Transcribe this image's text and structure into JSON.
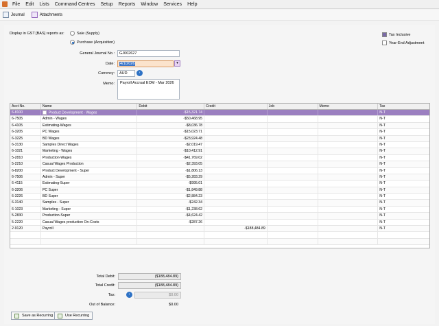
{
  "menu": [
    "File",
    "Edit",
    "Lists",
    "Command Centres",
    "Setup",
    "Reports",
    "Window",
    "Services",
    "Help"
  ],
  "toolbar": {
    "journal": "Journal",
    "attachments": "Attachments"
  },
  "gst": {
    "label": "Display in GST [BAS] reports as:",
    "sale": "Sale (Supply)",
    "purchase": "Purchase (Acquisition)",
    "selected": "purchase"
  },
  "options": {
    "tax_inclusive": "Tax Inclusive",
    "year_end": "Year-End Adjustment"
  },
  "form": {
    "journal_no_label": "General Journal No.:",
    "journal_no": "GJ002627",
    "date_label": "Date:",
    "date": "4/1/2026",
    "currency_label": "Currency:",
    "currency": "AUD",
    "memo_label": "Memo:",
    "memo": "Payroll Accrual EOM - Mar 2026"
  },
  "columns": [
    "Acct No.",
    "Name",
    "Debit",
    "Credit",
    "Job",
    "Memo",
    "Tax"
  ],
  "rows": [
    {
      "acct": "6-8100",
      "name": "Product Development - Wages",
      "debit": "-$15,321.74",
      "credit": "",
      "job": "",
      "memo": "",
      "tax": "N-T"
    },
    {
      "acct": "6-7505",
      "name": "Admin - Wages",
      "debit": "-$50,468.95",
      "credit": "",
      "job": "",
      "memo": "",
      "tax": "N-T"
    },
    {
      "acct": "6-4105",
      "name": "Estimating-Wages",
      "debit": "-$8,036.78",
      "credit": "",
      "job": "",
      "memo": "",
      "tax": "N-T"
    },
    {
      "acct": "6-3205",
      "name": "PC Wages",
      "debit": "-$15,023.71",
      "credit": "",
      "job": "",
      "memo": "",
      "tax": "N-T"
    },
    {
      "acct": "6-3225",
      "name": "BD Wages",
      "debit": "-$23,924.48",
      "credit": "",
      "job": "",
      "memo": "",
      "tax": "N-T"
    },
    {
      "acct": "6-3130",
      "name": "Samples Direct Wages",
      "debit": "-$2,019.47",
      "credit": "",
      "job": "",
      "memo": "",
      "tax": "N-T"
    },
    {
      "acct": "6-1021",
      "name": "Marketing - Wages",
      "debit": "-$10,412.91",
      "credit": "",
      "job": "",
      "memo": "",
      "tax": "N-T"
    },
    {
      "acct": "5-2810",
      "name": "Production-Wages",
      "debit": "-$41,769.02",
      "credit": "",
      "job": "",
      "memo": "",
      "tax": "N-T"
    },
    {
      "acct": "5-2210",
      "name": "Casual Wages Production",
      "debit": "-$2,393.05",
      "credit": "",
      "job": "",
      "memo": "",
      "tax": "N-T"
    },
    {
      "acct": "6-8200",
      "name": "Product Development - Super",
      "debit": "-$1,806.13",
      "credit": "",
      "job": "",
      "memo": "",
      "tax": "N-T"
    },
    {
      "acct": "6-7506",
      "name": "Admin - Super",
      "debit": "-$5,283.29",
      "credit": "",
      "job": "",
      "memo": "",
      "tax": "N-T"
    },
    {
      "acct": "6-4115",
      "name": "Estimating-Super",
      "debit": "-$995.01",
      "credit": "",
      "job": "",
      "memo": "",
      "tax": "N-T"
    },
    {
      "acct": "6-3206",
      "name": "PC Super",
      "debit": "-$1,849.88",
      "credit": "",
      "job": "",
      "memo": "",
      "tax": "N-T"
    },
    {
      "acct": "6-3226",
      "name": "BD Super",
      "debit": "-$2,884.23",
      "credit": "",
      "job": "",
      "memo": "",
      "tax": "N-T"
    },
    {
      "acct": "6-3140",
      "name": "Samples - Super",
      "debit": "-$242.34",
      "credit": "",
      "job": "",
      "memo": "",
      "tax": "N-T"
    },
    {
      "acct": "6-1023",
      "name": "Marketing - Super",
      "debit": "-$1,238.62",
      "credit": "",
      "job": "",
      "memo": "",
      "tax": "N-T"
    },
    {
      "acct": "5-2830",
      "name": "Production-Super",
      "debit": "-$4,624.42",
      "credit": "",
      "job": "",
      "memo": "",
      "tax": "N-T"
    },
    {
      "acct": "5-2220",
      "name": "Casual Wages production On-Costs",
      "debit": "-$287.26",
      "credit": "",
      "job": "",
      "memo": "",
      "tax": "N-T"
    },
    {
      "acct": "2-9120",
      "name": "Payroll",
      "debit": "",
      "credit": "-$188,484.89",
      "job": "",
      "memo": "",
      "tax": "N-T"
    }
  ],
  "totals": {
    "debit_label": "Total Debit:",
    "debit": "($188,484.89)",
    "credit_label": "Total Credit:",
    "credit": "($188,484.89)",
    "tax_label": "Tax:",
    "tax": "$0.00",
    "oob_label": "Out of Balance:",
    "oob": "$0.00"
  },
  "buttons": {
    "save_recurring": "Save as Recurring",
    "use_recurring": "Use Recurring"
  },
  "colors": {
    "selected_row": "#9b7fc0",
    "accent": "#2e72c5",
    "date_field": "#fbe3cc"
  }
}
